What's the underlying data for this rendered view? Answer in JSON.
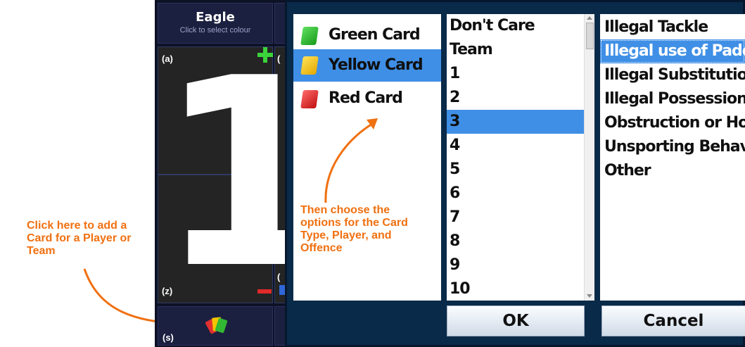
{
  "team": {
    "name": "Eagle",
    "hint": "Click to select colour"
  },
  "score": {
    "value": "1",
    "tag_a": "(a)",
    "tag_z": "(z)",
    "tag_s": "(s)",
    "plus_glyph": "+"
  },
  "annotations": {
    "add_card": "Click here to add a Card for a Player or Team",
    "choose_options": "Then choose the options for the Card Type, Player, and Offence"
  },
  "card_types": [
    {
      "label": "Green Card",
      "color": "#2eb82e"
    },
    {
      "label": "Yellow Card",
      "color": "#f2c200",
      "selected": true
    },
    {
      "label": "Red Card",
      "color": "#d62020"
    }
  ],
  "players": [
    "Don't Care",
    "Team",
    "1",
    "2",
    "3",
    "4",
    "5",
    "6",
    "7",
    "8",
    "9",
    "10"
  ],
  "players_selected": "3",
  "offences": [
    "Illegal Tackle",
    "Illegal use of Paddle",
    "Illegal Substitution",
    "Illegal Possession",
    "Obstruction or Holding",
    "Unsporting Behaviour",
    "Other"
  ],
  "offences_selected": "Illegal use of Paddle",
  "buttons": {
    "ok": "OK",
    "cancel": "Cancel"
  }
}
